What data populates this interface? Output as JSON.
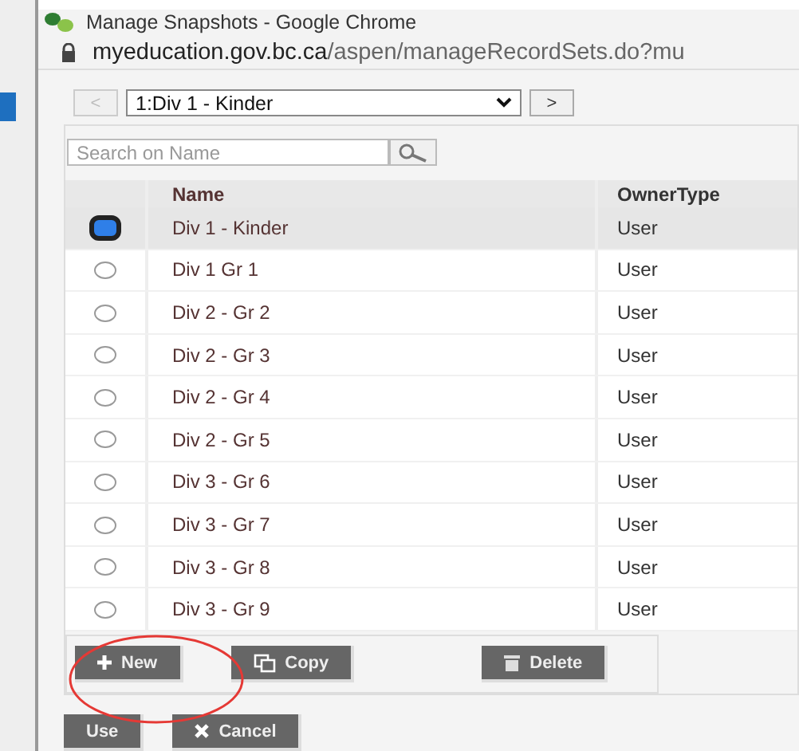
{
  "window": {
    "title": "Manage Snapshots - Google Chrome"
  },
  "address_bar": {
    "domain": "myeducation.gov.bc.ca",
    "path": "/aspen/manageRecordSets.do?mu"
  },
  "navigator": {
    "previous": "<",
    "selection": "1:Div 1 - Kinder",
    "next": ">"
  },
  "search": {
    "placeholder": "Search on Name"
  },
  "table": {
    "columns": [
      "Name",
      "OwnerType"
    ],
    "rows": [
      {
        "name": "Div 1 - Kinder",
        "owner_type": "User",
        "selected": true
      },
      {
        "name": "Div 1 Gr 1",
        "owner_type": "User",
        "selected": false
      },
      {
        "name": "Div 2 - Gr 2",
        "owner_type": "User",
        "selected": false
      },
      {
        "name": "Div 2 - Gr 3",
        "owner_type": "User",
        "selected": false
      },
      {
        "name": "Div 2 - Gr 4",
        "owner_type": "User",
        "selected": false
      },
      {
        "name": "Div 2 - Gr 5",
        "owner_type": "User",
        "selected": false
      },
      {
        "name": "Div 3 - Gr 6",
        "owner_type": "User",
        "selected": false
      },
      {
        "name": "Div 3 - Gr 7",
        "owner_type": "User",
        "selected": false
      },
      {
        "name": "Div 3 - Gr 8",
        "owner_type": "User",
        "selected": false
      },
      {
        "name": "Div 3 - Gr 9",
        "owner_type": "User",
        "selected": false
      }
    ]
  },
  "actions": [
    {
      "label": "New",
      "kind": "new"
    },
    {
      "label": "Copy",
      "kind": "copy"
    },
    {
      "label": "Delete",
      "kind": "delete"
    }
  ],
  "footer_buttons": [
    {
      "label": "Use",
      "kind": "use"
    },
    {
      "label": "Cancel",
      "kind": "cancel"
    }
  ]
}
